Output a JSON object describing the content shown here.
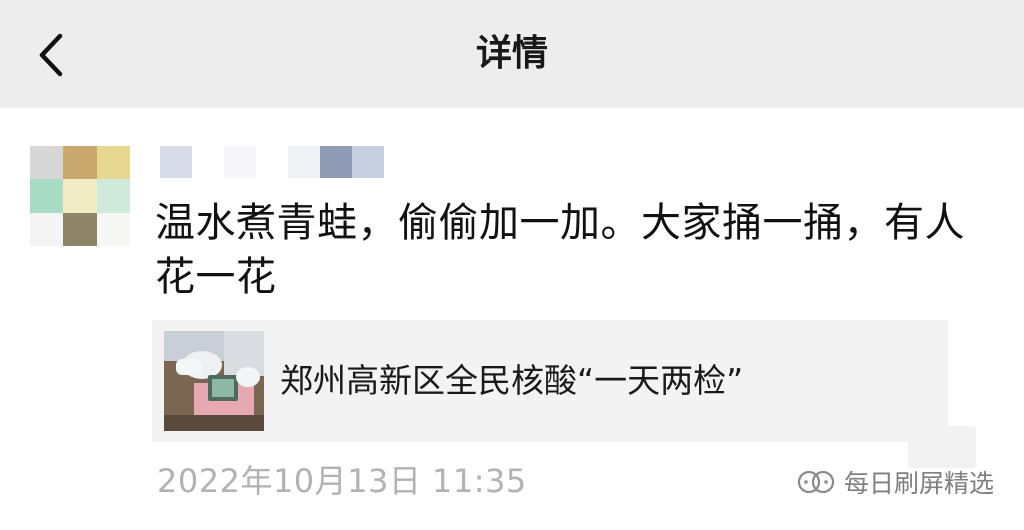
{
  "header": {
    "title": "详情",
    "back_icon": "chevron-left-icon"
  },
  "post": {
    "content": "温水煮青蛙，偷偷加一加。大家捅一捅，有人花一花",
    "link": {
      "title": "郑州高新区全民核酸“一天两检”"
    },
    "timestamp": "2022年10月13日 11:35"
  },
  "watermark": {
    "text": "每日刷屏精选",
    "icon": "wechat-official-account-icon"
  },
  "colors": {
    "header_bg": "#ededed",
    "text_primary": "#111111",
    "text_secondary": "#b2b2b2",
    "card_bg": "#f3f3f3"
  }
}
